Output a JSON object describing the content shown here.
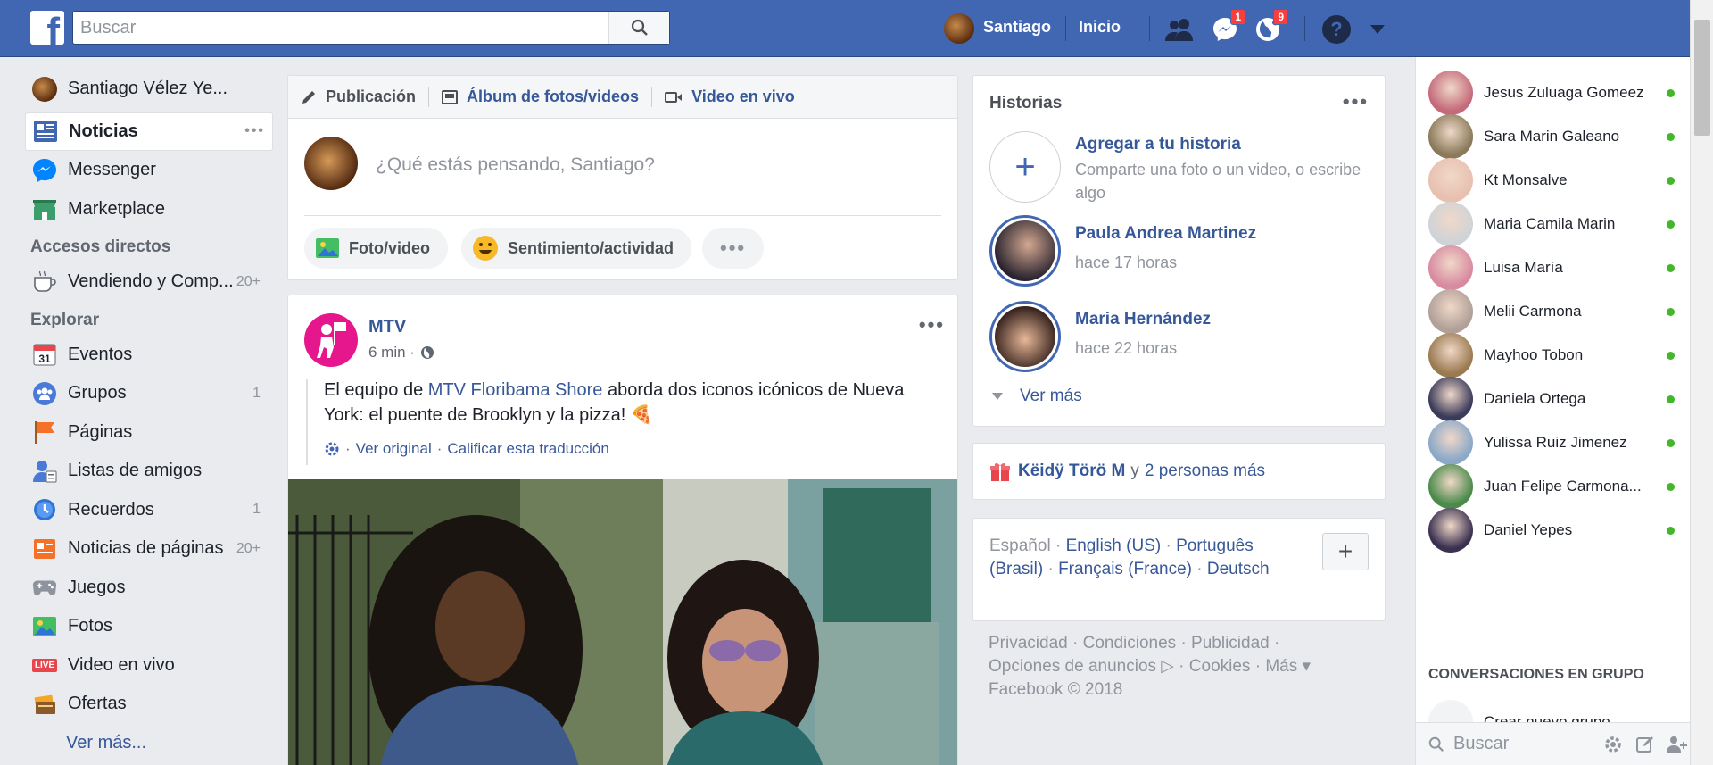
{
  "topbar": {
    "logo": "f",
    "search_placeholder": "Buscar",
    "user_name": "Santiago",
    "home_label": "Inicio",
    "messages_badge": "1",
    "notifications_badge": "9",
    "help": "?"
  },
  "leftnav": {
    "profile_name": "Santiago Vélez Ye...",
    "items": [
      {
        "label": "Noticias",
        "more": "•••"
      },
      {
        "label": "Messenger"
      },
      {
        "label": "Marketplace"
      }
    ],
    "shortcuts_title": "Accesos directos",
    "shortcuts": [
      {
        "label": "Vendiendo y Comp...",
        "count": "20+"
      }
    ],
    "explore_title": "Explorar",
    "explore": [
      {
        "label": "Eventos",
        "count": ""
      },
      {
        "label": "Grupos",
        "count": "1"
      },
      {
        "label": "Páginas",
        "count": ""
      },
      {
        "label": "Listas de amigos",
        "count": ""
      },
      {
        "label": "Recuerdos",
        "count": "1"
      },
      {
        "label": "Noticias de páginas",
        "count": "20+"
      },
      {
        "label": "Juegos",
        "count": ""
      },
      {
        "label": "Fotos",
        "count": ""
      },
      {
        "label": "Video en vivo",
        "count": ""
      },
      {
        "label": "Ofertas",
        "count": ""
      }
    ],
    "see_more": "Ver más..."
  },
  "composer": {
    "tabs": [
      "Publicación",
      "Álbum de fotos/videos",
      "Video en vivo"
    ],
    "placeholder": "¿Qué estás pensando, Santiago?",
    "photo_label": "Foto/video",
    "feeling_label": "Sentimiento/actividad",
    "more": "•••"
  },
  "post": {
    "author": "MTV",
    "time": "6 min ·",
    "text_before": "El equipo de ",
    "text_link": "MTV Floribama Shore",
    "text_after": " aborda dos iconos icónicos de Nueva York: el puente de Brooklyn y la pizza! 🍕",
    "see_original": "Ver original",
    "rate_translation": "Calificar esta traducción",
    "more": "•••"
  },
  "stories": {
    "title": "Historias",
    "more": "•••",
    "add_title": "Agregar a tu historia",
    "add_subtitle": "Comparte una foto o un video, o escribe algo",
    "items": [
      {
        "name": "Paula Andrea Martinez",
        "time": "hace 17 horas"
      },
      {
        "name": "Maria Hernández",
        "time": "hace 22 horas"
      }
    ],
    "see_more": "Ver más"
  },
  "birthday": {
    "name": "Këidÿ Törö M",
    "connector": "y",
    "others": "2 personas más"
  },
  "languages": {
    "current": "Español ·",
    "options": [
      "English (US)",
      "Português (Brasil)",
      "Français (France)",
      "Deutsch"
    ],
    "add": "+"
  },
  "footer": {
    "line1": "Privacidad · Condiciones · Publicidad ·",
    "line2": "Opciones de anuncios ▷ · Cookies · Más ▾",
    "line3": "Facebook © 2018"
  },
  "chat": {
    "contacts": [
      {
        "name": "Jesus Zuluaga Gomeez",
        "color": "#c46a7a"
      },
      {
        "name": "Sara Marin Galeano",
        "color": "#8a7a5a"
      },
      {
        "name": "Kt Monsalve",
        "color": "#e8c0b0"
      },
      {
        "name": "Maria Camila Marin",
        "color": "#cfd3d8"
      },
      {
        "name": "Luisa María",
        "color": "#d88aa0"
      },
      {
        "name": "Melii Carmona",
        "color": "#b0a098"
      },
      {
        "name": "Mayhoo Tobon",
        "color": "#9a7a50"
      },
      {
        "name": "Daniela Ortega",
        "color": "#3a3a5a"
      },
      {
        "name": "Yulissa Ruiz Jimenez",
        "color": "#8aa8c8"
      },
      {
        "name": "Juan Felipe Carmona...",
        "color": "#4a8a4a"
      },
      {
        "name": "Daniel Yepes",
        "color": "#3a3050"
      }
    ],
    "group_title": "CONVERSACIONES EN GRUPO",
    "group_new": "Crear nuevo grupo",
    "search_placeholder": "Buscar"
  }
}
